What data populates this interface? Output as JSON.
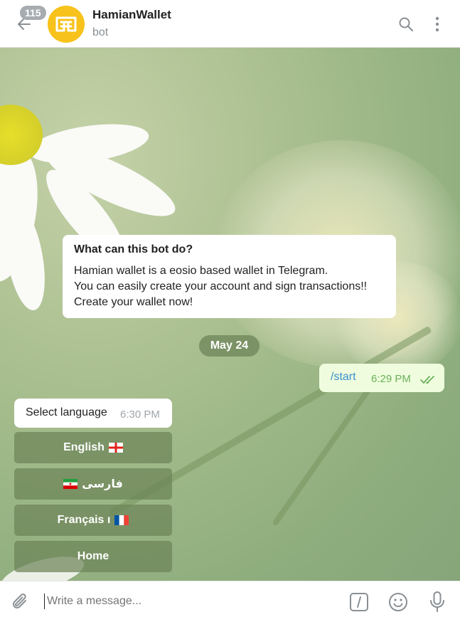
{
  "header": {
    "back_icon": "arrow-left-icon",
    "unread_badge": "115",
    "title": "HamianWallet",
    "subtitle": "bot",
    "search_icon": "search-icon",
    "menu_icon": "more-vertical-icon",
    "avatar_color": "#f7c21b"
  },
  "bot_info": {
    "title": "What can this bot do?",
    "lines": [
      "Hamian wallet is a eosio based wallet in Telegram.",
      "You can easily create your account and sign transactions!!",
      "Create your wallet now!"
    ]
  },
  "date_separator": "May 24",
  "messages": [
    {
      "direction": "outgoing",
      "text": "/start",
      "time": "6:29 PM",
      "status": "read"
    },
    {
      "direction": "incoming",
      "text": "Select language",
      "time": "6:30 PM"
    }
  ],
  "keyboard_buttons": [
    {
      "label": "English",
      "flag": "england-flag-icon"
    },
    {
      "label": "فارسی",
      "flag": "iran-flag-icon"
    },
    {
      "label": "Français ı",
      "flag": "france-flag-icon"
    },
    {
      "label": "Home",
      "flag": ""
    }
  ],
  "composer": {
    "placeholder": "Write a message...",
    "attach_icon": "paperclip-icon",
    "command_icon": "slash-command-icon",
    "emoji_icon": "smiley-icon",
    "mic_icon": "microphone-icon"
  }
}
